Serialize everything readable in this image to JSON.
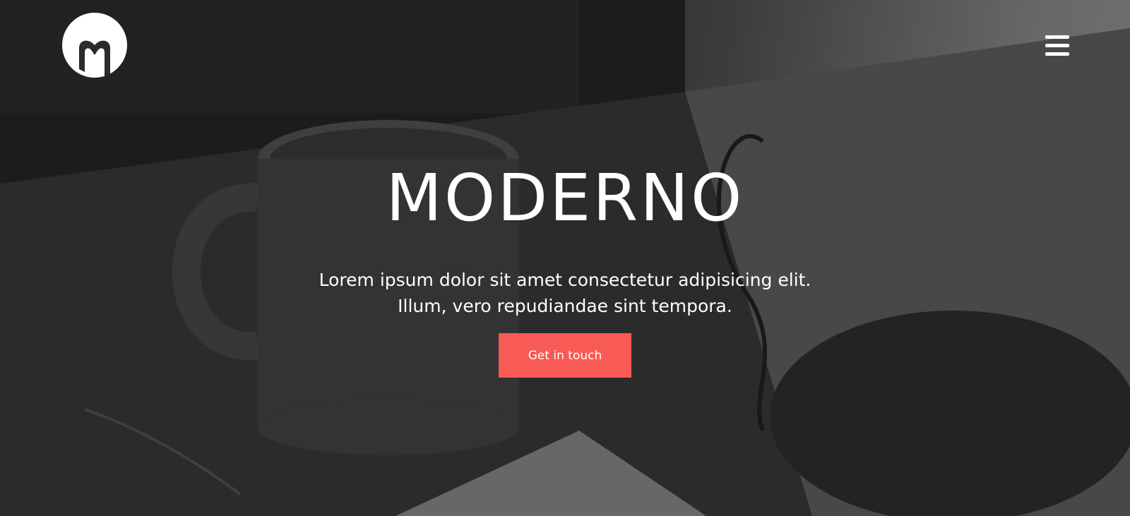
{
  "brand": {
    "logo_icon": "m-logo-icon"
  },
  "nav": {
    "menu_icon": "hamburger-menu-icon"
  },
  "hero": {
    "title": "MODERNO",
    "subtitle_line1": "Lorem ipsum dolor sit amet consectetur adipisicing elit.",
    "subtitle_line2": "Illum, vero repudiandae sint tempora.",
    "cta_label": "Get in touch"
  },
  "colors": {
    "accent": "#f85a55",
    "text": "#ffffff"
  }
}
